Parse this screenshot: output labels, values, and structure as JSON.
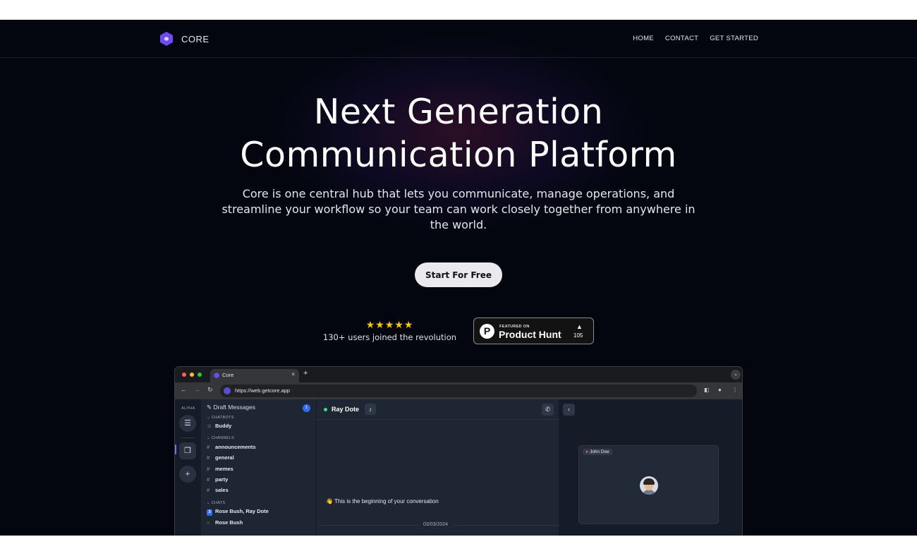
{
  "nav": {
    "brand": "CORE",
    "links": [
      "HOME",
      "CONTACT",
      "GET STARTED"
    ]
  },
  "hero": {
    "title_line1": "Next Generation",
    "title_line2": "Communication Platform",
    "subtitle": "Core is one central hub that lets you communicate, manage operations, and streamline your workflow so your team can work closely together from anywhere in the world.",
    "cta_label": "Start For Free"
  },
  "social_proof": {
    "stars": "★★★★★",
    "rating": 5,
    "text": "130+ users joined the revolution"
  },
  "product_hunt": {
    "logo_letter": "P",
    "featured_label": "FEATURED ON",
    "name": "Product Hunt",
    "arrow": "▲",
    "count": "105"
  },
  "browser": {
    "tab_title": "Core",
    "tab_close": "×",
    "new_tab": "+",
    "url": "https://web.getcore.app"
  },
  "app": {
    "rail_label": "ALPHA",
    "sidebar": {
      "draft_label": "Draft Messages",
      "draft_count": "1",
      "chatbots_heading": "CHATBOTS",
      "chatbots": [
        "Buddy"
      ],
      "channels_heading": "CHANNELS",
      "channels": [
        "announcements",
        "general",
        "memes",
        "party",
        "sales"
      ],
      "chats_heading": "CHATS",
      "chats": [
        {
          "name": "Rose Bush, Ray Dote",
          "badge": "3"
        },
        {
          "name": "Rose Bush"
        }
      ]
    },
    "chat": {
      "contact_name": "Ray Dote",
      "begin_text": "👋 This is the beginning of your conversation",
      "date": "03/03/2024"
    },
    "video": {
      "participant": "John Doe"
    }
  },
  "colors": {
    "background": "#03060f",
    "brand": "#6c4bf5",
    "accent_blue": "#2f6bff",
    "star": "#f5c518"
  }
}
